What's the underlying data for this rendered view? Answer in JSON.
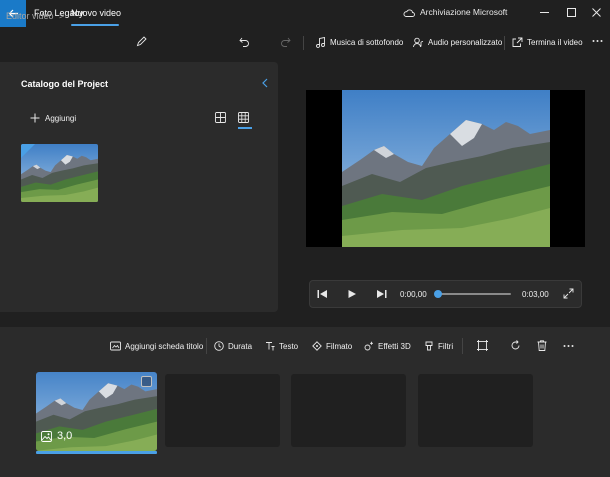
{
  "titlebar": {
    "app_title": "Foto Legacy",
    "cloud_label": "Archiviazione Microsoft",
    "accent": "#1a7ac8"
  },
  "toolbar": {
    "breadcrumb_root": "Editor video",
    "breadcrumb_separator": ">",
    "breadcrumb_current": "Nuovo video",
    "music_label": "Musica di sottofondo",
    "custom_audio_label": "Audio personalizzato",
    "finish_label": "Termina il video"
  },
  "library": {
    "title": "Catalogo del Project",
    "add_label": "Aggiungi"
  },
  "player": {
    "current_time": "0:00,00",
    "end_time": "0:03,00",
    "progress": 0
  },
  "storyboard": {
    "add_title_card_label": "Aggiungi scheda titolo",
    "duration_label": "Durata",
    "text_label": "Testo",
    "motion_label": "Filmato",
    "effects_3d_label": "Effetti 3D",
    "filters_label": "Filtri",
    "clips": [
      {
        "duration": "3,0",
        "selected": true
      }
    ]
  },
  "colors": {
    "accent": "#4aa0e6",
    "panel": "#2b2b2b",
    "background": "#202020"
  }
}
